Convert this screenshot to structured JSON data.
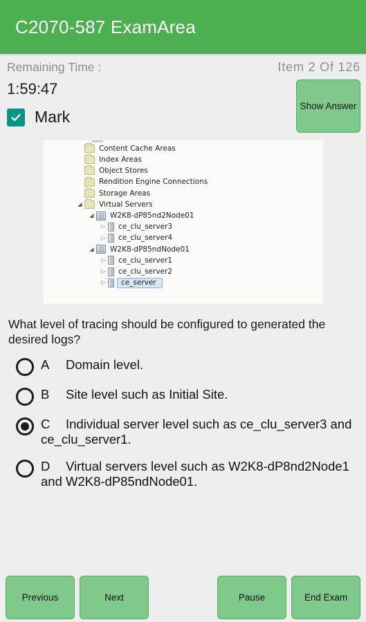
{
  "header": {
    "title": "C2070-587 ExamArea",
    "bg_color": "#4caf50"
  },
  "status": {
    "remaining_time_label": "Remaining Time :",
    "item_counter": "Item 2 Of 126",
    "timer_value": "1:59:47"
  },
  "mark": {
    "label": "Mark",
    "checked": "true",
    "checkbox_color": "#009688"
  },
  "show_answer": {
    "label": "Show Answer",
    "bg_color": "#7fc98a"
  },
  "exhibit": {
    "tree": [
      {
        "indent": 1,
        "arrow": "",
        "icon": "folder-icon",
        "label": "Content Cache Areas"
      },
      {
        "indent": 1,
        "arrow": "",
        "icon": "folder-icon",
        "label": "Index Areas"
      },
      {
        "indent": 1,
        "arrow": "",
        "icon": "folder-icon",
        "label": "Object Stores"
      },
      {
        "indent": 1,
        "arrow": "",
        "icon": "folder-icon",
        "label": "Rendition Engine Connections"
      },
      {
        "indent": 1,
        "arrow": "",
        "icon": "folder-icon",
        "label": "Storage Areas"
      },
      {
        "indent": 1,
        "arrow": "expanded",
        "icon": "folder-icon",
        "label": "Virtual Servers"
      },
      {
        "indent": 2,
        "arrow": "expanded",
        "icon": "cluster-icon",
        "label": "W2K8-dP85nd2Node01"
      },
      {
        "indent": 3,
        "arrow": "collapsed",
        "icon": "server-icon",
        "label": "ce_clu_server3"
      },
      {
        "indent": 3,
        "arrow": "collapsed",
        "icon": "server-icon",
        "label": "ce_clu_server4"
      },
      {
        "indent": 2,
        "arrow": "expanded",
        "icon": "cluster-icon",
        "label": "W2K8-dP85ndNode01"
      },
      {
        "indent": 3,
        "arrow": "collapsed",
        "icon": "server-icon",
        "label": "ce_clu_server1"
      },
      {
        "indent": 3,
        "arrow": "collapsed",
        "icon": "server-icon",
        "label": "ce_clu_server2"
      },
      {
        "indent": 3,
        "arrow": "collapsed",
        "icon": "server-icon",
        "label": "ce_server",
        "selected": "true"
      }
    ]
  },
  "question": {
    "text": "What level of tracing should be configured to generated the desired logs?"
  },
  "options": [
    {
      "letter": "A",
      "text": "Domain level.",
      "selected": false
    },
    {
      "letter": "B",
      "text": "Site level such as Initial Site.",
      "selected": false
    },
    {
      "letter": "C",
      "text": "Individual server level such as ce_clu_server3 and ce_clu_server1.",
      "selected": true
    },
    {
      "letter": "D",
      "text": "Virtual servers level such as W2K8-dP8nd2Node1 and W2K8-dP85ndNode01.",
      "selected": false
    }
  ],
  "bottom_bar": {
    "previous_label": "Previous",
    "next_label": "Next",
    "pause_label": "Pause",
    "end_exam_label": "End Exam"
  }
}
